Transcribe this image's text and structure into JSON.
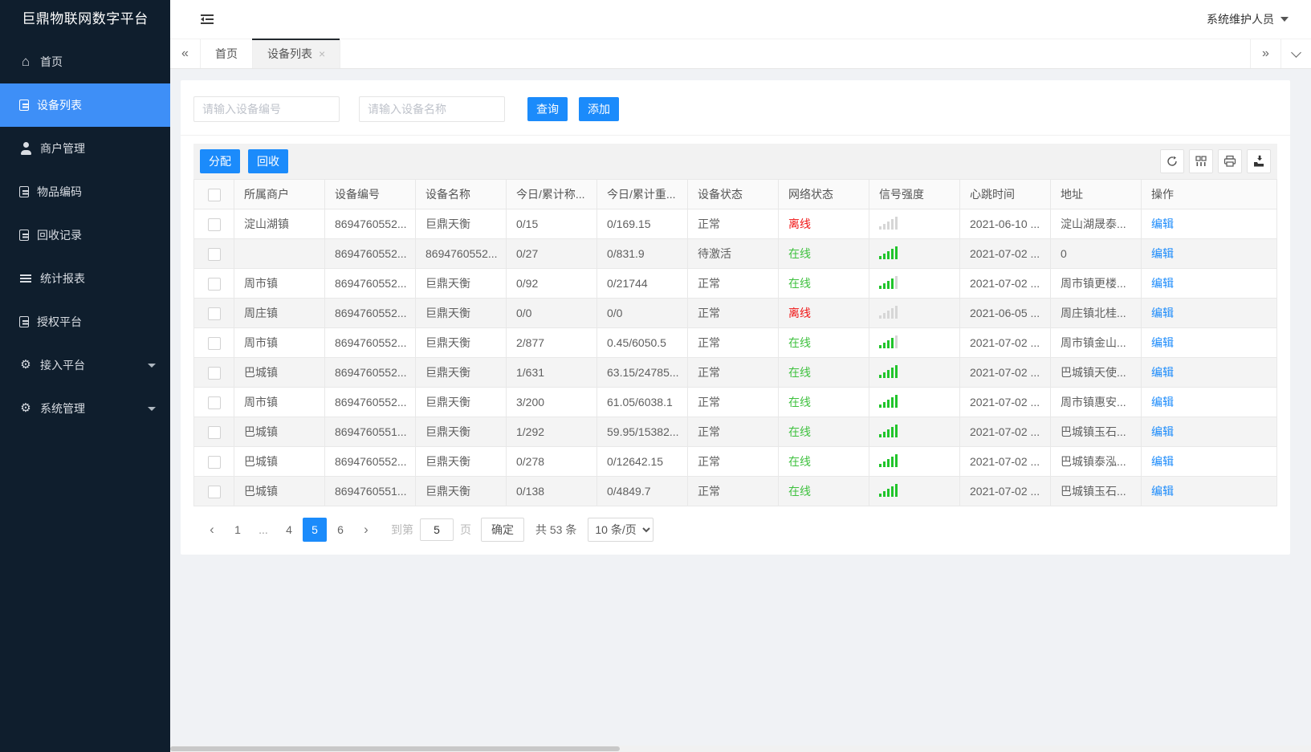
{
  "app": {
    "title": "巨鼎物联网数字平台",
    "user": "系统维护人员"
  },
  "colors": {
    "sidebar_bg": "#0f1e2d",
    "sidebar_active": "#3e8ff7",
    "primary_blue": "#1b8bfb",
    "online_green": "#3fc13f",
    "offline_red": "#f01616",
    "signal_green": "#21c42b",
    "link_blue": "#1b8bfb"
  },
  "sidebar": {
    "items": [
      {
        "id": "home",
        "label": "首页",
        "icon": "home-icon",
        "active": false,
        "has_arrow": false
      },
      {
        "id": "device-list",
        "label": "设备列表",
        "icon": "doc-icon",
        "active": true,
        "has_arrow": false
      },
      {
        "id": "merchant-mgmt",
        "label": "商户管理",
        "icon": "user-icon",
        "active": false,
        "has_arrow": false
      },
      {
        "id": "item-code",
        "label": "物品编码",
        "icon": "doc-icon",
        "active": false,
        "has_arrow": false
      },
      {
        "id": "recycle-record",
        "label": "回收记录",
        "icon": "doc-icon",
        "active": false,
        "has_arrow": false
      },
      {
        "id": "report",
        "label": "统计报表",
        "icon": "list-icon",
        "active": false,
        "has_arrow": false
      },
      {
        "id": "auth-platform",
        "label": "授权平台",
        "icon": "doc-icon",
        "active": false,
        "has_arrow": false
      },
      {
        "id": "access-platform",
        "label": "接入平台",
        "icon": "gear-icon",
        "active": false,
        "has_arrow": true
      },
      {
        "id": "system-mgmt",
        "label": "系统管理",
        "icon": "gear-icon",
        "active": false,
        "has_arrow": true
      }
    ]
  },
  "tabs": {
    "items": [
      {
        "label": "首页",
        "active": false,
        "closable": false
      },
      {
        "label": "设备列表",
        "active": true,
        "closable": true
      }
    ]
  },
  "search": {
    "device_no_placeholder": "请输入设备编号",
    "device_name_placeholder": "请输入设备名称",
    "query_label": "查询",
    "add_label": "添加"
  },
  "toolbar": {
    "assign_label": "分配",
    "recycle_label": "回收",
    "icons": [
      "refresh-icon",
      "columns-icon",
      "print-icon",
      "export-icon"
    ]
  },
  "table": {
    "columns": [
      "所属商户",
      "设备编号",
      "设备名称",
      "今日/累计称...",
      "今日/累计重...",
      "设备状态",
      "网络状态",
      "信号强度",
      "心跳时间",
      "地址",
      "操作"
    ],
    "rows": [
      {
        "merchant": "淀山湖镇",
        "device_no": "8694760552...",
        "device_name": "巨鼎天衡",
        "today_count": "0/15",
        "today_weight": "0/169.15",
        "device_status": "正常",
        "network_status": "离线",
        "online": false,
        "signal": 0,
        "heartbeat": "2021-06-10 ...",
        "address": "淀山湖晟泰...",
        "action": "编辑"
      },
      {
        "merchant": "",
        "device_no": "8694760552...",
        "device_name": "8694760552...",
        "today_count": "0/27",
        "today_weight": "0/831.9",
        "device_status": "待激活",
        "network_status": "在线",
        "online": true,
        "signal": 5,
        "heartbeat": "2021-07-02 ...",
        "address": "0",
        "action": "编辑"
      },
      {
        "merchant": "周市镇",
        "device_no": "8694760552...",
        "device_name": "巨鼎天衡",
        "today_count": "0/92",
        "today_weight": "0/21744",
        "device_status": "正常",
        "network_status": "在线",
        "online": true,
        "signal": 4,
        "heartbeat": "2021-07-02 ...",
        "address": "周市镇更楼...",
        "action": "编辑"
      },
      {
        "merchant": "周庄镇",
        "device_no": "8694760552...",
        "device_name": "巨鼎天衡",
        "today_count": "0/0",
        "today_weight": "0/0",
        "device_status": "正常",
        "network_status": "离线",
        "online": false,
        "signal": 0,
        "heartbeat": "2021-06-05 ...",
        "address": "周庄镇北桂...",
        "action": "编辑"
      },
      {
        "merchant": "周市镇",
        "device_no": "8694760552...",
        "device_name": "巨鼎天衡",
        "today_count": "2/877",
        "today_weight": "0.45/6050.5",
        "device_status": "正常",
        "network_status": "在线",
        "online": true,
        "signal": 4,
        "heartbeat": "2021-07-02 ...",
        "address": "周市镇金山...",
        "action": "编辑"
      },
      {
        "merchant": "巴城镇",
        "device_no": "8694760552...",
        "device_name": "巨鼎天衡",
        "today_count": "1/631",
        "today_weight": "63.15/24785...",
        "device_status": "正常",
        "network_status": "在线",
        "online": true,
        "signal": 5,
        "heartbeat": "2021-07-02 ...",
        "address": "巴城镇天使...",
        "action": "编辑"
      },
      {
        "merchant": "周市镇",
        "device_no": "8694760552...",
        "device_name": "巨鼎天衡",
        "today_count": "3/200",
        "today_weight": "61.05/6038.1",
        "device_status": "正常",
        "network_status": "在线",
        "online": true,
        "signal": 5,
        "heartbeat": "2021-07-02 ...",
        "address": "周市镇惠安...",
        "action": "编辑"
      },
      {
        "merchant": "巴城镇",
        "device_no": "8694760551...",
        "device_name": "巨鼎天衡",
        "today_count": "1/292",
        "today_weight": "59.95/15382...",
        "device_status": "正常",
        "network_status": "在线",
        "online": true,
        "signal": 5,
        "heartbeat": "2021-07-02 ...",
        "address": "巴城镇玉石...",
        "action": "编辑"
      },
      {
        "merchant": "巴城镇",
        "device_no": "8694760552...",
        "device_name": "巨鼎天衡",
        "today_count": "0/278",
        "today_weight": "0/12642.15",
        "device_status": "正常",
        "network_status": "在线",
        "online": true,
        "signal": 5,
        "heartbeat": "2021-07-02 ...",
        "address": "巴城镇泰泓...",
        "action": "编辑"
      },
      {
        "merchant": "巴城镇",
        "device_no": "8694760551...",
        "device_name": "巨鼎天衡",
        "today_count": "0/138",
        "today_weight": "0/4849.7",
        "device_status": "正常",
        "network_status": "在线",
        "online": true,
        "signal": 5,
        "heartbeat": "2021-07-02 ...",
        "address": "巴城镇玉石...",
        "action": "编辑"
      }
    ]
  },
  "pagination": {
    "prev": "‹",
    "next": "›",
    "pages": [
      "1",
      "...",
      "4",
      "5",
      "6"
    ],
    "active_page": "5",
    "goto_label": "到第",
    "goto_value": "5",
    "page_unit": "页",
    "confirm_label": "确定",
    "total_label": "共 53 条",
    "page_size": "10 条/页"
  }
}
